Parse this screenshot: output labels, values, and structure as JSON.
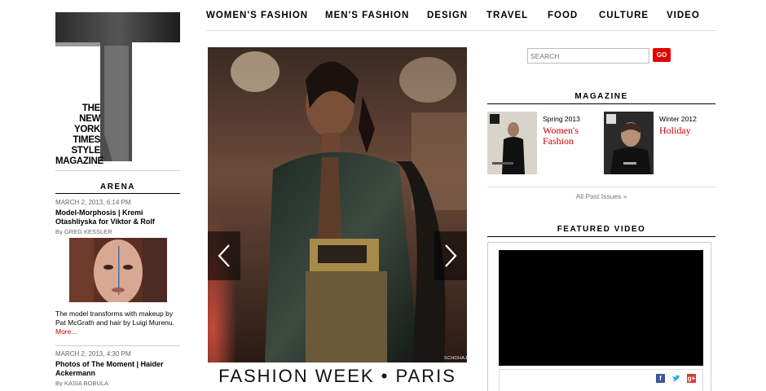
{
  "brand": {
    "logo_text": [
      "THE",
      "NEW YORK",
      "TIMES",
      "STYLE",
      "MAGAZINE"
    ]
  },
  "nav": {
    "items": [
      "WOMEN'S FASHION",
      "MEN'S FASHION",
      "DESIGN",
      "TRAVEL",
      "FOOD",
      "CULTURE",
      "VIDEO"
    ]
  },
  "arena": {
    "heading": "ARENA",
    "articles": [
      {
        "date": "MARCH 2, 2013, 6:14 PM",
        "title": "Model-Morphosis | Kremi Otashliyska for Viktor & Rolf",
        "byline": "By GREG KESSLER",
        "summary": "The model transforms with makeup by Pat McGrath and hair by Luigi Murenu.",
        "more": "More..."
      },
      {
        "date": "MARCH 2, 2013, 4:30 PM",
        "title": "Photos of The Moment | Haider Ackermann",
        "byline": "By KASIA BOBULA"
      }
    ]
  },
  "hero": {
    "caption": "FASHION WEEK • PARIS",
    "credit": "SCHOHAJA",
    "prev_icon": "chevron-left-icon",
    "next_icon": "chevron-right-icon"
  },
  "search": {
    "placeholder": "SEARCH",
    "button_label": "GO"
  },
  "magazine": {
    "heading": "MAGAZINE",
    "issues": [
      {
        "season": "Spring 2013",
        "title": "Women's Fashion"
      },
      {
        "season": "Winter 2012",
        "title": "Holiday"
      }
    ],
    "all_past_label": "All Past Issues »"
  },
  "featured_video": {
    "heading": "FEATURED VIDEO",
    "share_icons": [
      "facebook-icon",
      "twitter-icon",
      "google-plus-icon"
    ]
  },
  "colors": {
    "accent_red": "#e10000",
    "link_red": "#cc0000"
  }
}
